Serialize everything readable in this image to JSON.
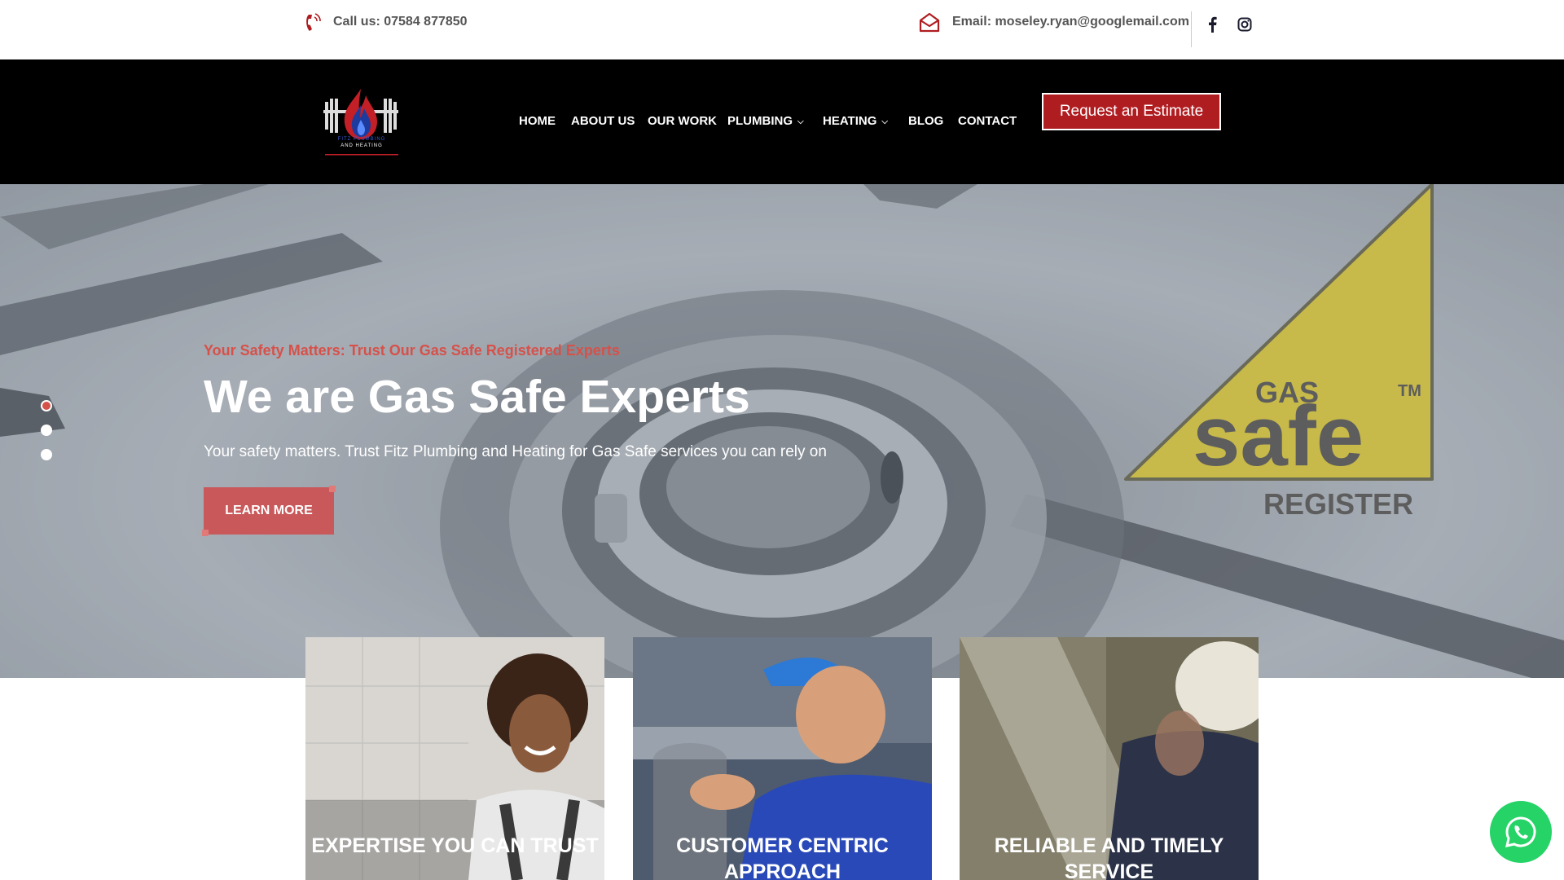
{
  "topbar": {
    "phone_text": "Call us: 07584 877850",
    "email_text": "Email: moseley.ryan@googlemail.com",
    "icons": [
      "phone-icon",
      "mail-icon",
      "facebook-icon",
      "instagram-icon"
    ]
  },
  "nav": {
    "logo_line1": "FITZ PLUMBING",
    "logo_line2": "AND HEATING",
    "items": [
      {
        "label": "HOME"
      },
      {
        "label": "ABOUT US"
      },
      {
        "label": "OUR WORK"
      },
      {
        "label": "PLUMBING"
      },
      {
        "label": "HEATING"
      },
      {
        "label": "BLOG"
      },
      {
        "label": "CONTACT"
      }
    ],
    "cta": "Request an Estimate"
  },
  "hero": {
    "subtitle": "Your Safety Matters: Trust Our Gas Safe Registered Experts",
    "title": "We are Gas Safe Experts",
    "description": "Your safety matters. Trust Fitz Plumbing and Heating for Gas Safe services you can rely on",
    "button": "LEARN MORE",
    "slides_total": 3,
    "active_slide": 1,
    "badge": {
      "gas": "GAS",
      "safe": "safe",
      "tm": "TM",
      "register": "REGISTER"
    }
  },
  "cards": [
    {
      "title": "EXPERTISE YOU CAN TRUST"
    },
    {
      "title": "CUSTOMER CENTRIC APPROACH"
    },
    {
      "title": "RELIABLE AND TIMELY SERVICE"
    }
  ],
  "colors": {
    "accent": "#d6514a",
    "brand_red": "#b01d21",
    "nav_bg": "#000000",
    "whatsapp": "#25d366"
  }
}
